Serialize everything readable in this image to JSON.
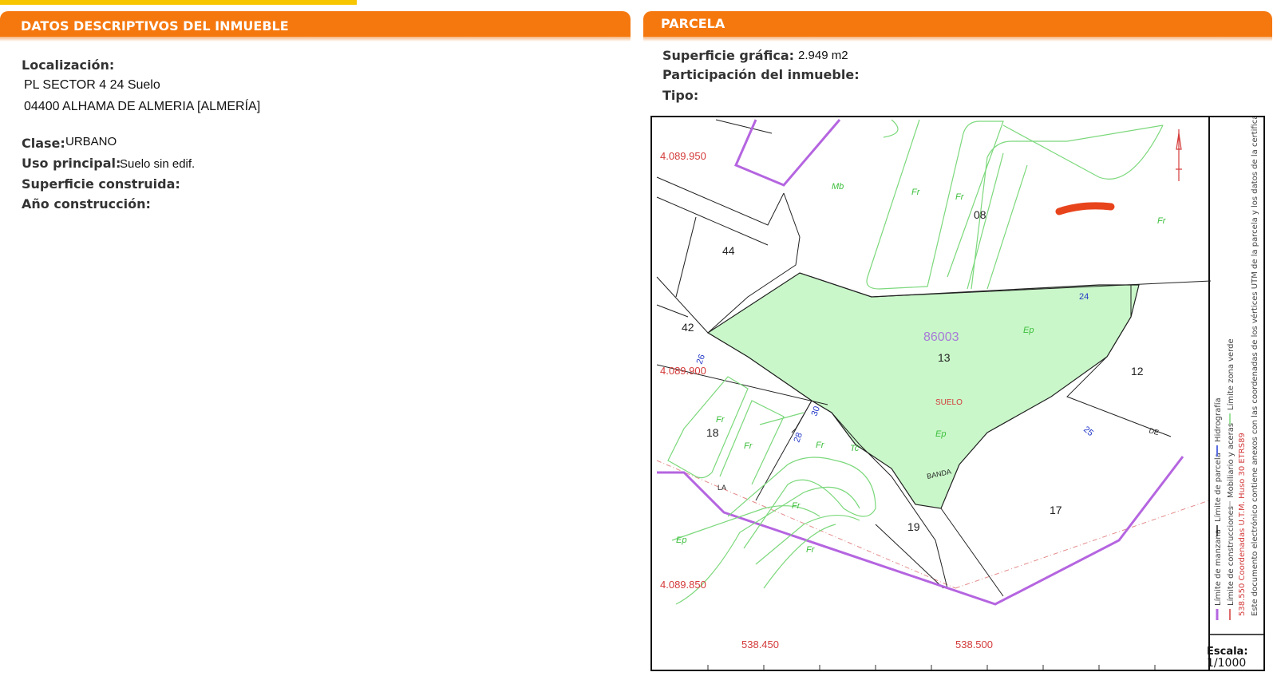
{
  "left_section": {
    "title": "DATOS DESCRIPTIVOS DEL INMUEBLE",
    "localizacion_label": "Localización:",
    "localizacion_line1": "PL SECTOR 4 24 Suelo",
    "localizacion_line2": "04400 ALHAMA DE ALMERIA [ALMERÍA]",
    "clase_label": "Clase:",
    "clase_value": "URBANO",
    "uso_label": "Uso principal:",
    "uso_value": "Suelo sin edif.",
    "superficie_construida_label": "Superficie construida:",
    "anio_label": "Año construcción:"
  },
  "right_section": {
    "title": "PARCELA",
    "superficie_grafica_label": "Superficie gráfica:",
    "superficie_grafica_value": "2.949 m2",
    "participacion_label": "Participación del inmueble:",
    "tipo_label": "Tipo:"
  },
  "map": {
    "coord_y": [
      "4.089.950",
      "4.089.900",
      "4.089.850"
    ],
    "coord_x": [
      "538.450",
      "538.500"
    ],
    "parcel_ref": "86003",
    "parcel_number": "13",
    "parcel_use": "SUELO",
    "block_numbers": [
      "44",
      "42",
      "08",
      "12",
      "18",
      "17",
      "19"
    ],
    "street_numbers": [
      "24",
      "26",
      "30",
      "28",
      "25"
    ],
    "zone_codes": [
      "Mb",
      "Fr",
      "Fr",
      "Fr",
      "Ep",
      "Fr",
      "Fr",
      "Fr",
      "Ep",
      "Tc",
      "Fr",
      "Ep",
      "Fr"
    ],
    "street_words": [
      "DE",
      "BANDA",
      "LA"
    ],
    "legend": {
      "limite_manzana": "Límite de manzana",
      "limite_parcela": "Límite de parcela",
      "hidrografia": "Hidrografía",
      "limite_construcciones": "Límite de construcciones",
      "mobiliario": "Mobiliario y aceras",
      "zona_verde": "Límite zona verde",
      "coord_note": "538.550 Coordenadas U.T.M. Huso 30 ETRS89",
      "document_note": "Este documento electrónico contiene anexos con las coordenadas de los vértices UTM de la parcela y los datos de la certificación"
    },
    "scale_label": "Escala:",
    "scale_value": "1/1000",
    "colors": {
      "parcel_fill": "#c9f7c9",
      "block_line": "#b565e0",
      "green_line": "#7bd87b",
      "coord_red": "#d43a3a",
      "header_orange": "#f5780f",
      "top_bar_yellow": "#f7c600"
    }
  }
}
